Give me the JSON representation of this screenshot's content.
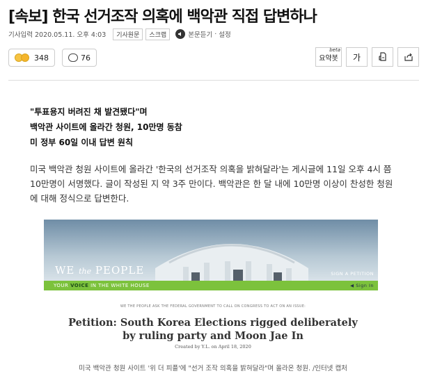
{
  "article": {
    "title": "[속보] 한국 선거조작 의혹에 백악관 직접 답변하나",
    "date": "기사입력 2020.05.11. 오후 4:03",
    "chips": [
      "기사원문",
      "스크랩"
    ],
    "speaker_label": "본문듣기",
    "settings_label": "설정"
  },
  "reactions": {
    "emoji_count": "348",
    "comment_count": "76"
  },
  "tools": {
    "summary": "요약봇",
    "beta": "beta",
    "font": "가"
  },
  "subheads": [
    "\"투표용지 버려진 채 발견됐다\"며",
    "백악관 사이트에 올라간 청원, 10만명 동참",
    "미 정부 60일 이내 답변 원칙"
  ],
  "body": "미국 백악관 청원 사이트에 올라간 '한국의 선거조작 의혹을 밝혀달라'는 게시글에 11일 오후 4시 쯤 10만명이 서명했다. 글이 작성된 지 약 3주 만이다. 백악관은 한 달 내에 10만명 이상이 찬성한 청원에 대해 정식으로 답변한다.",
  "image": {
    "we": "WE ",
    "the": "the",
    "people": " PEOPLE",
    "sign_petition": "SIGN A PETITION",
    "bar_pre": "YOUR ",
    "bar_voice": "VOICE",
    "bar_post": " IN THE WHITE HOUSE",
    "sign_in": "◀ Sign In",
    "ask_line": "WE THE PEOPLE ASK THE FEDERAL GOVERNMENT TO CALL ON CONGRESS TO ACT ON AN ISSUE:",
    "petition_line1": "Petition: South Korea Elections rigged deliberately",
    "petition_line2": "by ruling party and Moon Jae In",
    "byline": "Created by Y.L. on April 18, 2020"
  },
  "caption": "미국 백악관 청원 사이트 '위 더 피플'에 \"선거 조작 의혹을 밝혀달라\"며 올라온 청원. /인터넷 캡처"
}
